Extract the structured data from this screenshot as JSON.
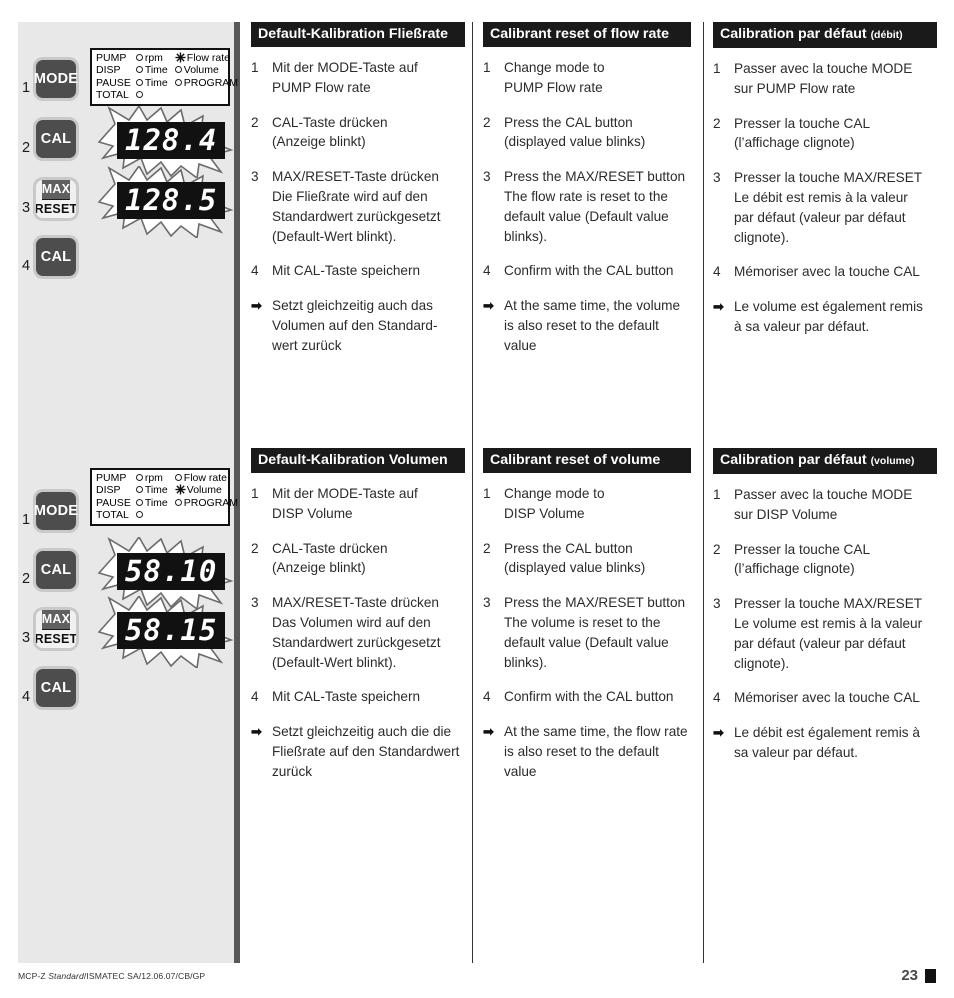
{
  "document": {
    "footer_left_prefix": "MCP-Z ",
    "footer_left_italic": "Standard",
    "footer_left_suffix": "/ISMATEC SA/12.06.07/CB/GP",
    "page_number": "23"
  },
  "sidebar": {
    "flowrate_group": {
      "steps": [
        "1",
        "2",
        "3",
        "4"
      ],
      "buttons": {
        "mode": "MODE",
        "cal": "CAL",
        "max": "MAX",
        "reset": "RESET",
        "cal2": "CAL"
      },
      "lcd_panel": {
        "rows": [
          {
            "c1": "PUMP",
            "c2": "rpm",
            "c2_marker": "dot",
            "c3": "Flow rate",
            "c3_marker": "star"
          },
          {
            "c1": "DISP",
            "c2": "Time",
            "c2_marker": "dot",
            "c3": "Volume",
            "c3_marker": "dot"
          },
          {
            "c1": "PAUSE",
            "c2": "Time",
            "c2_marker": "dot",
            "c3": "PROGRAM",
            "c3_marker": "dot"
          },
          {
            "c1": "TOTAL",
            "c2": "",
            "c2_marker": "dot",
            "c3": "",
            "c3_marker": "none"
          }
        ]
      },
      "display_before": "128.4",
      "display_after": "128.5"
    },
    "volume_group": {
      "steps": [
        "1",
        "2",
        "3",
        "4"
      ],
      "buttons": {
        "mode": "MODE",
        "cal": "CAL",
        "max": "MAX",
        "reset": "RESET",
        "cal2": "CAL"
      },
      "lcd_panel": {
        "rows": [
          {
            "c1": "PUMP",
            "c2": "rpm",
            "c2_marker": "dot",
            "c3": "Flow rate",
            "c3_marker": "dot"
          },
          {
            "c1": "DISP",
            "c2": "Time",
            "c2_marker": "dot",
            "c3": "Volume",
            "c3_marker": "star"
          },
          {
            "c1": "PAUSE",
            "c2": "Time",
            "c2_marker": "dot",
            "c3": "PROGRAM",
            "c3_marker": "dot"
          },
          {
            "c1": "TOTAL",
            "c2": "",
            "c2_marker": "dot",
            "c3": "",
            "c3_marker": "none"
          }
        ]
      },
      "display_before": "58.10",
      "display_after": "58.15"
    }
  },
  "sections": {
    "flowrate": {
      "de": {
        "heading": "Default-Kalibration Fließrate",
        "heading_paren": "",
        "steps": [
          {
            "marker": "1",
            "lines": [
              "Mit der MODE-Taste auf",
              "PUMP Flow rate"
            ]
          },
          {
            "marker": "2",
            "lines": [
              "CAL-Taste drücken",
              "(Anzeige blinkt)"
            ]
          },
          {
            "marker": "3",
            "lines": [
              "MAX/RESET-Taste drücken",
              "Die Fließrate wird auf den",
              "Standardwert zurückgesetzt",
              "(Default-Wert blinkt)."
            ]
          },
          {
            "marker": "4",
            "lines": [
              "Mit CAL-Taste speichern"
            ]
          },
          {
            "marker": "➡",
            "lines": [
              "Setzt gleichzeitig auch das",
              "Volumen auf den Standard-",
              "wert zurück"
            ]
          }
        ]
      },
      "en": {
        "heading": "Calibrant reset of flow rate",
        "heading_paren": "",
        "steps": [
          {
            "marker": "1",
            "lines": [
              "Change mode to",
              "PUMP Flow rate"
            ]
          },
          {
            "marker": "2",
            "lines": [
              "Press the CAL button",
              "(displayed value blinks)"
            ]
          },
          {
            "marker": "3",
            "lines": [
              "Press the MAX/RESET button",
              "The flow rate is reset to the",
              "default value (Default value",
              "blinks)."
            ]
          },
          {
            "marker": "4",
            "lines": [
              "Confirm with the CAL button"
            ]
          },
          {
            "marker": "➡",
            "lines": [
              "At the same time, the volume",
              "is also reset to the default value"
            ]
          }
        ]
      },
      "fr": {
        "heading": "Calibration par défaut ",
        "heading_paren": "(débit)",
        "steps": [
          {
            "marker": "1",
            "lines": [
              "Passer avec la touche MODE",
              "sur PUMP Flow rate"
            ]
          },
          {
            "marker": "2",
            "lines": [
              "Presser la touche CAL",
              "(l’affichage clignote)"
            ]
          },
          {
            "marker": "3",
            "lines": [
              "Presser la touche MAX/RESET",
              "Le débit est remis à la valeur",
              "par défaut (valeur par défaut",
              "clignote)."
            ]
          },
          {
            "marker": "4",
            "lines": [
              "Mémoriser avec la touche CAL"
            ]
          },
          {
            "marker": "➡",
            "lines": [
              "Le volume est également remis",
              "à sa valeur par défaut."
            ]
          }
        ]
      }
    },
    "volume": {
      "de": {
        "heading": "Default-Kalibration Volumen",
        "heading_paren": "",
        "steps": [
          {
            "marker": "1",
            "lines": [
              "Mit der MODE-Taste auf",
              "DISP Volume"
            ]
          },
          {
            "marker": "2",
            "lines": [
              "CAL-Taste drücken",
              "(Anzeige blinkt)"
            ]
          },
          {
            "marker": "3",
            "lines": [
              "MAX/RESET-Taste drücken",
              "Das Volumen wird auf den",
              "Standardwert zurückgesetzt",
              "(Default-Wert blinkt)."
            ]
          },
          {
            "marker": "4",
            "lines": [
              "Mit CAL-Taste speichern"
            ]
          },
          {
            "marker": "➡",
            "lines": [
              "Setzt gleichzeitig auch die die",
              "Fließrate auf den Standardwert",
              "zurück"
            ]
          }
        ]
      },
      "en": {
        "heading": "Calibrant reset of volume",
        "heading_paren": "",
        "steps": [
          {
            "marker": "1",
            "lines": [
              "Change mode to",
              "DISP Volume"
            ]
          },
          {
            "marker": "2",
            "lines": [
              "Press the CAL button",
              "(displayed value blinks)"
            ]
          },
          {
            "marker": "3",
            "lines": [
              "Press the MAX/RESET button",
              "The volume is reset to the",
              "default value (Default value",
              "blinks)."
            ]
          },
          {
            "marker": "4",
            "lines": [
              "Confirm with the CAL button"
            ]
          },
          {
            "marker": "➡",
            "lines": [
              "At the same time, the flow rate",
              "is also reset to the default value"
            ]
          }
        ]
      },
      "fr": {
        "heading": "Calibration par défaut ",
        "heading_paren": "(volume)",
        "steps": [
          {
            "marker": "1",
            "lines": [
              "Passer avec la touche MODE",
              "sur DISP Volume"
            ]
          },
          {
            "marker": "2",
            "lines": [
              "Presser la touche CAL",
              "(l’affichage clignote)"
            ]
          },
          {
            "marker": "3",
            "lines": [
              "Presser la touche MAX/RESET",
              "Le volume est remis à la valeur",
              "par défaut (valeur par défaut",
              "clignote)."
            ]
          },
          {
            "marker": "4",
            "lines": [
              "Mémoriser avec la touche CAL"
            ]
          },
          {
            "marker": "➡",
            "lines": [
              "Le débit est également remis à",
              "sa valeur par défaut."
            ]
          }
        ]
      }
    }
  }
}
